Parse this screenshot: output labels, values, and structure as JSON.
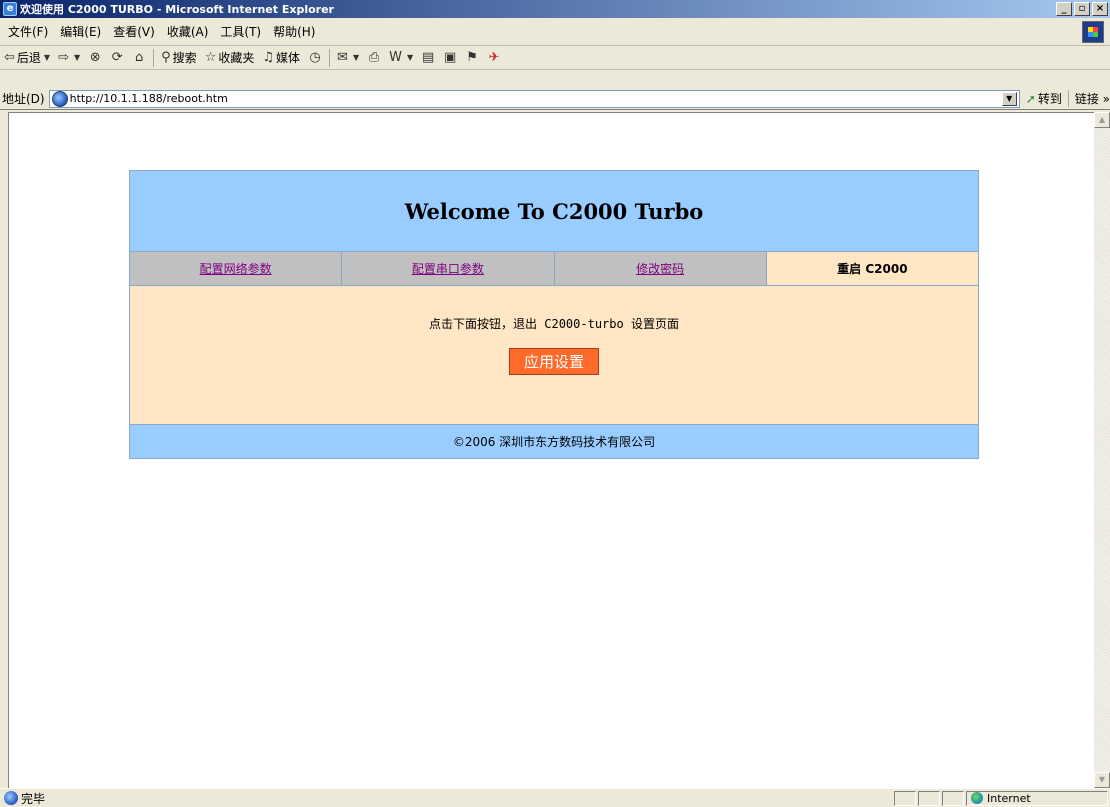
{
  "window": {
    "title": "欢迎使用 C2000 TURBO - Microsoft Internet Explorer",
    "controls": [
      "_",
      "▫",
      "×"
    ]
  },
  "menu": [
    "文件(F)",
    "编辑(E)",
    "查看(V)",
    "收藏(A)",
    "工具(T)",
    "帮助(H)"
  ],
  "toolbar": {
    "back": "后退",
    "search": "搜索",
    "favorites": "收藏夹",
    "media": "媒体"
  },
  "address": {
    "label": "地址(D)",
    "url": "http://10.1.1.188/reboot.htm",
    "go": "转到",
    "links": "链接 »"
  },
  "page": {
    "welcome": "Welcome To C2000 Turbo",
    "nav": [
      {
        "label": "配置网络参数",
        "active": false
      },
      {
        "label": "配置串口参数",
        "active": false
      },
      {
        "label": "修改密码",
        "active": false
      },
      {
        "label": "重启 C2000",
        "active": true
      }
    ],
    "instruction": "点击下面按钮，退出 C2000-turbo 设置页面",
    "apply_button": "应用设置",
    "footer": "©2006 深圳市东方数码技术有限公司"
  },
  "status": {
    "text": "完毕",
    "zone": "Internet"
  },
  "colors": {
    "header_blue": "#99ccff",
    "body_peach": "#ffe6c4",
    "nav_gray": "#c0c0c0",
    "button_orange": "#ff6a2a",
    "link_visited": "#800080"
  }
}
